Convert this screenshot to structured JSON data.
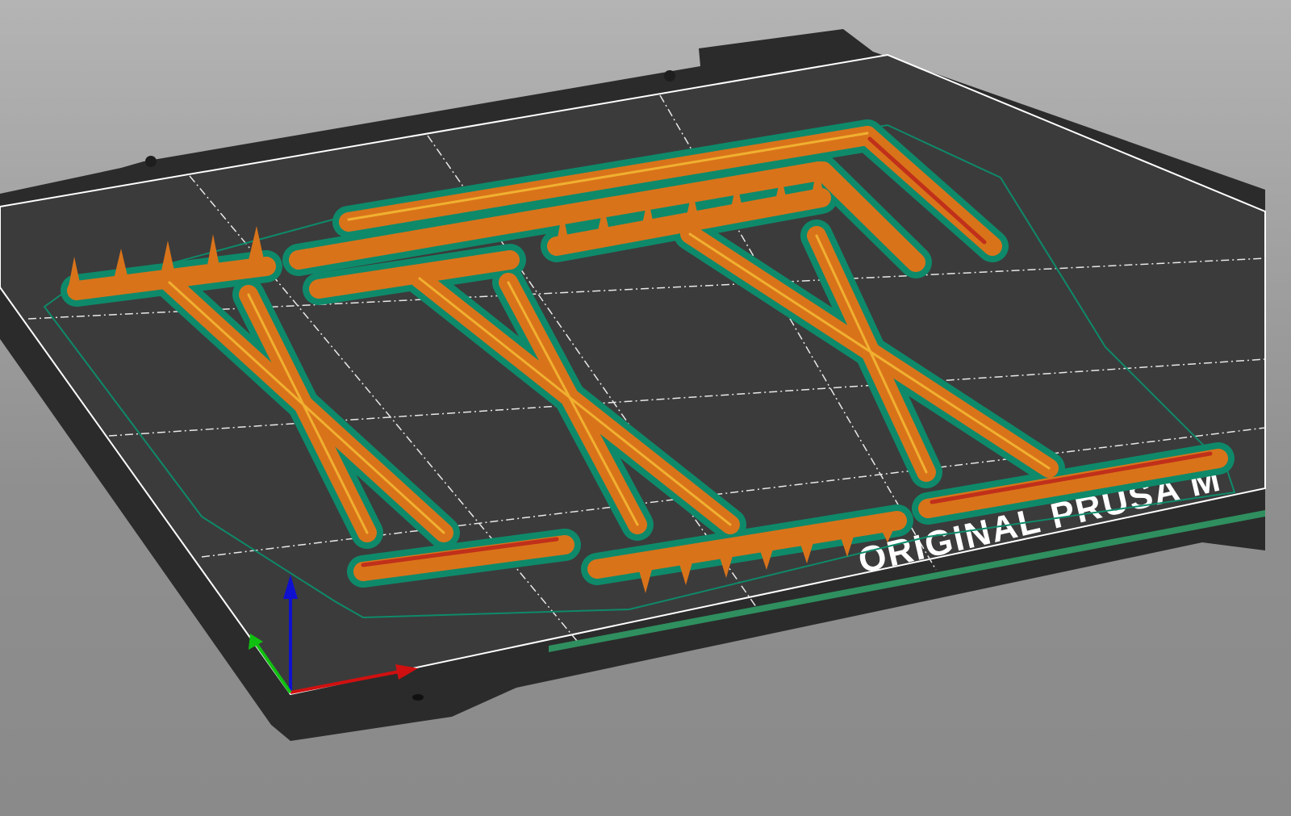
{
  "viewport": {
    "bed_label": "ORIGINAL PRUSA M",
    "colors": {
      "background": "#a0a0a0",
      "bed": "#2e2e2e",
      "print_surface": "#3a3a3a",
      "extrusion": "#d9731a",
      "extrusion_highlight": "#f0b030",
      "skirt": "#0e8a6a",
      "axis_x": "#d01010",
      "axis_y": "#10c010",
      "axis_z": "#1010d0"
    }
  }
}
